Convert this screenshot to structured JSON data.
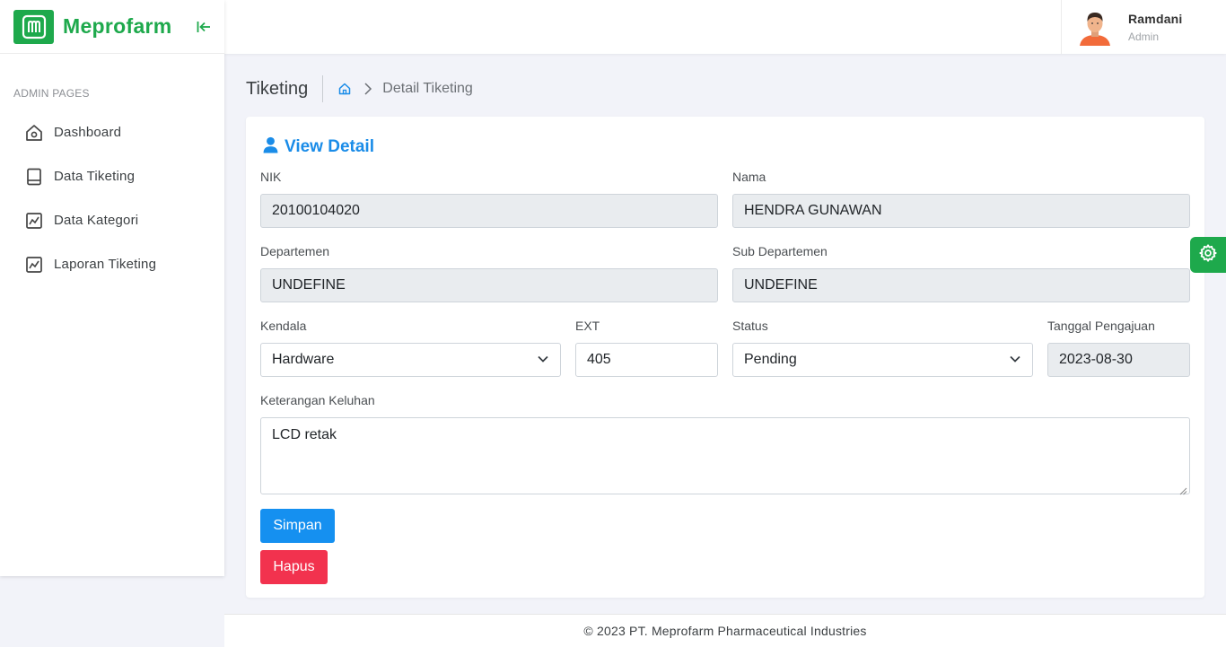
{
  "brand": {
    "name": "Meprofarm",
    "logo_icon": "meprofarm-logo",
    "accent": "#1ea94c"
  },
  "sidebar": {
    "section_title": "ADMIN PAGES",
    "items": [
      {
        "label": "Dashboard",
        "icon": "home-icon"
      },
      {
        "label": "Data Tiketing",
        "icon": "book-icon"
      },
      {
        "label": "Data Kategori",
        "icon": "chart-icon"
      },
      {
        "label": "Laporan Tiketing",
        "icon": "chart-icon"
      }
    ]
  },
  "user": {
    "name": "Ramdani",
    "role": "Admin"
  },
  "header": {
    "title": "Tiketing",
    "breadcrumb_current": "Detail Tiketing"
  },
  "card": {
    "title": "View Detail",
    "fields": {
      "nik": {
        "label": "NIK",
        "value": "20100104020"
      },
      "nama": {
        "label": "Nama",
        "value": "HENDRA GUNAWAN"
      },
      "departemen": {
        "label": "Departemen",
        "value": "UNDEFINE"
      },
      "sub_departemen": {
        "label": "Sub Departemen",
        "value": "UNDEFINE"
      },
      "kendala": {
        "label": "Kendala",
        "value": "Hardware"
      },
      "ext": {
        "label": "EXT",
        "value": "405"
      },
      "status": {
        "label": "Status",
        "value": "Pending"
      },
      "tanggal": {
        "label": "Tanggal Pengajuan",
        "value": "2023-08-30"
      },
      "keterangan": {
        "label": "Keterangan Keluhan",
        "value": "LCD retak"
      }
    },
    "buttons": {
      "save": "Simpan",
      "delete": "Hapus"
    }
  },
  "footer": {
    "text": "© 2023 PT. Meprofarm Pharmaceutical Industries"
  },
  "colors": {
    "primary": "#1590f0",
    "danger": "#f2324e",
    "title_blue": "#1a8ce8"
  }
}
